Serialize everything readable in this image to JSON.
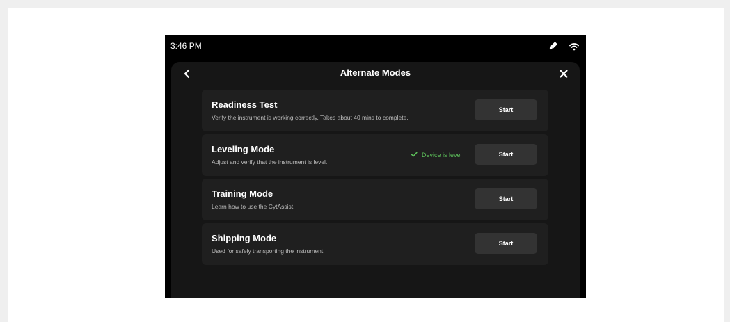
{
  "status_bar": {
    "time": "3:46 PM",
    "icons": [
      "usb-drive-icon",
      "wifi-icon"
    ]
  },
  "header": {
    "title": "Alternate Modes",
    "back_icon": "chevron-left-icon",
    "close_icon": "close-icon"
  },
  "modes": [
    {
      "title": "Readiness Test",
      "description": "Verify the instrument is working correctly. Takes about 40 mins to complete.",
      "button_label": "Start"
    },
    {
      "title": "Leveling Mode",
      "description": "Adjust and verify that the instrument is level.",
      "status": "Device is level",
      "button_label": "Start"
    },
    {
      "title": "Training Mode",
      "description": "Learn how to use the CytAssist.",
      "button_label": "Start"
    },
    {
      "title": "Shipping Mode",
      "description": "Used for safely transporting the instrument.",
      "button_label": "Start"
    }
  ],
  "colors": {
    "background": "#000000",
    "panel": "#161616",
    "card": "#1f1f1f",
    "button": "#333333",
    "success": "#5cbf5a"
  }
}
